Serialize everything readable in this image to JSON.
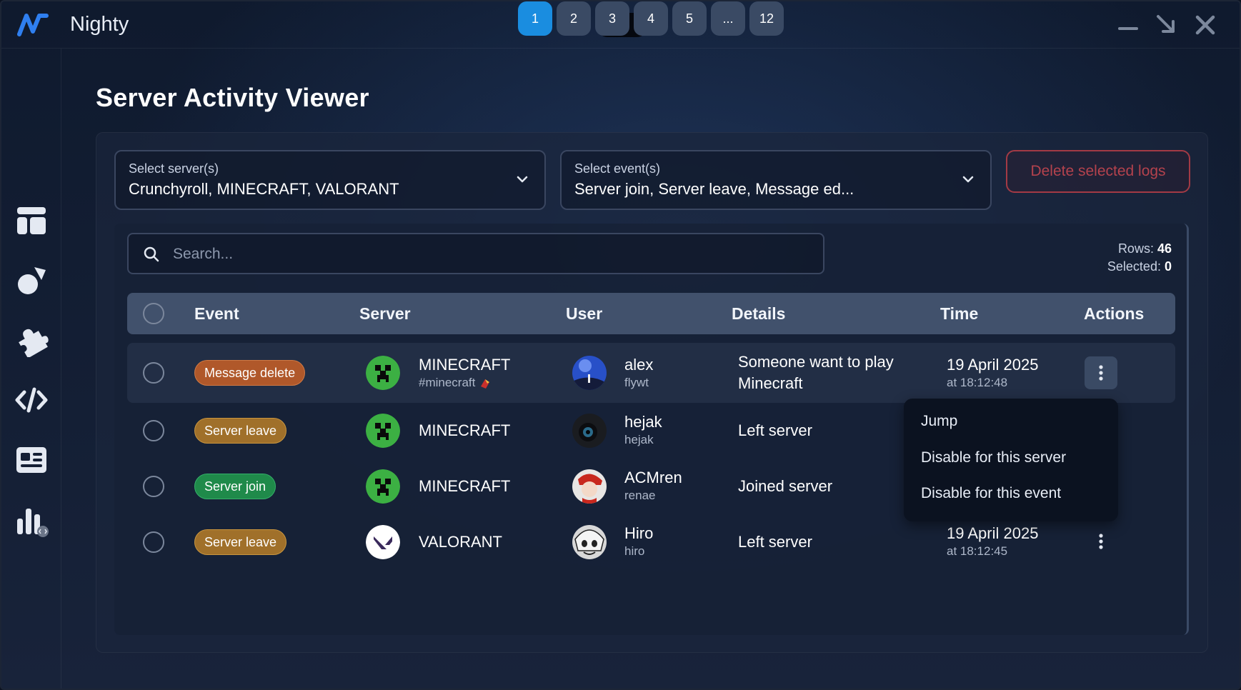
{
  "app": {
    "title": "Nighty"
  },
  "page": {
    "title": "Server Activity Viewer"
  },
  "filters": {
    "servers": {
      "label": "Select server(s)",
      "value": "Crunchyroll, MINECRAFT, VALORANT"
    },
    "events": {
      "label": "Select event(s)",
      "value": "Server join, Server leave, Message ed..."
    },
    "delete_label": "Delete selected logs"
  },
  "search": {
    "placeholder": "Search..."
  },
  "counts": {
    "rows_label": "Rows:",
    "rows": "46",
    "selected_label": "Selected:",
    "selected": "0"
  },
  "table": {
    "headers": {
      "event": "Event",
      "server": "Server",
      "user": "User",
      "details": "Details",
      "time": "Time",
      "actions": "Actions"
    },
    "rows": [
      {
        "event": "Message delete",
        "event_type": "delete",
        "server": "MINECRAFT",
        "server_sub": "#minecraft",
        "user": "alex",
        "handle": "flywt",
        "details_line1": "Someone want to play",
        "details_line2": "Minecraft",
        "date": "19 April 2025",
        "time": "at 18:12:48"
      },
      {
        "event": "Server leave",
        "event_type": "leave",
        "server": "MINECRAFT",
        "user": "hejak",
        "handle": "hejak",
        "details_line1": "Left server"
      },
      {
        "event": "Server join",
        "event_type": "join",
        "server": "MINECRAFT",
        "user": "ACMren",
        "handle": "renae",
        "details_line1": "Joined server"
      },
      {
        "event": "Server leave",
        "event_type": "leave",
        "server": "VALORANT",
        "user": "Hiro",
        "handle": "hiro",
        "details_line1": "Left server",
        "date": "19 April 2025",
        "time": "at 18:12:45"
      }
    ]
  },
  "context_menu": {
    "items": [
      "Jump",
      "Disable for this server",
      "Disable for this event"
    ]
  },
  "pagination": {
    "pages": [
      "1",
      "2",
      "3",
      "4",
      "5",
      "...",
      "12"
    ],
    "current": "1"
  },
  "colors": {
    "accent": "#1a8de0",
    "danger": "#b4424d",
    "header": "#41516c",
    "minecraft": "#3cb043"
  }
}
